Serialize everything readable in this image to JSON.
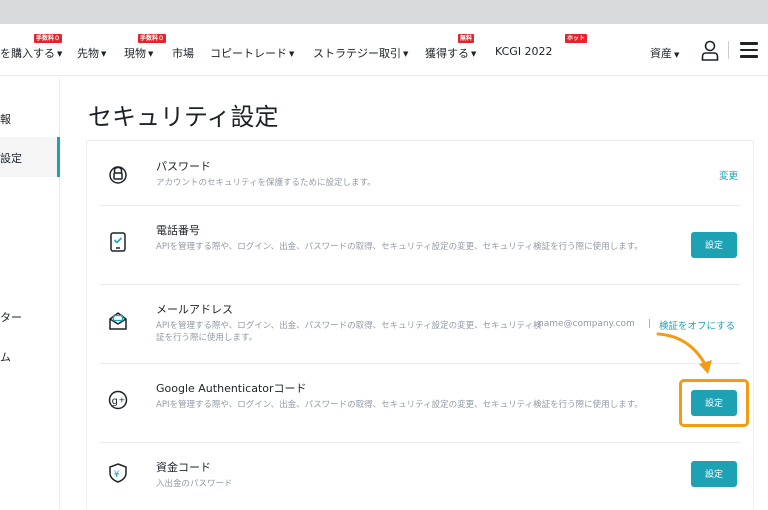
{
  "nav": {
    "items": [
      {
        "label": "を購入する",
        "tag": "手数料０"
      },
      {
        "label": "先物",
        "tag": ""
      },
      {
        "label": "現物",
        "tag": "手数料０"
      },
      {
        "label": "市場",
        "tag": ""
      },
      {
        "label": "コピートレード",
        "tag": ""
      },
      {
        "label": "ストラテジー取引",
        "tag": ""
      },
      {
        "label": "獲得する",
        "tag": "無料"
      },
      {
        "label": "KCGI 2022",
        "tag": "ホット"
      }
    ],
    "assets_label": "資産"
  },
  "sidebar": {
    "items": [
      {
        "label": "報"
      },
      {
        "label": "設定"
      },
      {
        "label": "ター"
      },
      {
        "label": "ム"
      }
    ]
  },
  "page_title": "セキュリティ設定",
  "rows": [
    {
      "title": "パスワード",
      "desc": "アカウントのセキュリティを保護するために設定します。",
      "action": "変更"
    },
    {
      "title": "電話番号",
      "desc": "APIを管理する際や、ログイン、出金、パスワードの取得、セキュリティ設定の変更、セキュリティ検証を行う際に使用します。",
      "action": "設定"
    },
    {
      "title": "メールアドレス",
      "desc": "APIを管理する際や、ログイン、出金、パスワードの取得、セキュリティ設定の変更、セキュリティ検証を行う際に使用します。",
      "email": "name@company.com",
      "separator": "|",
      "action": "検証をオフにする"
    },
    {
      "title": "Google Authenticatorコード",
      "desc": "APIを管理する際や、ログイン、出金、パスワードの取得、セキュリティ設定の変更、セキュリティ検証を行う際に使用します。",
      "action": "設定"
    },
    {
      "title": "資金コード",
      "desc": "入出金のパスワード",
      "action": "設定"
    }
  ],
  "colors": {
    "accent": "#1da2b4",
    "highlight": "#f39c12",
    "tag": "#e8222b"
  }
}
